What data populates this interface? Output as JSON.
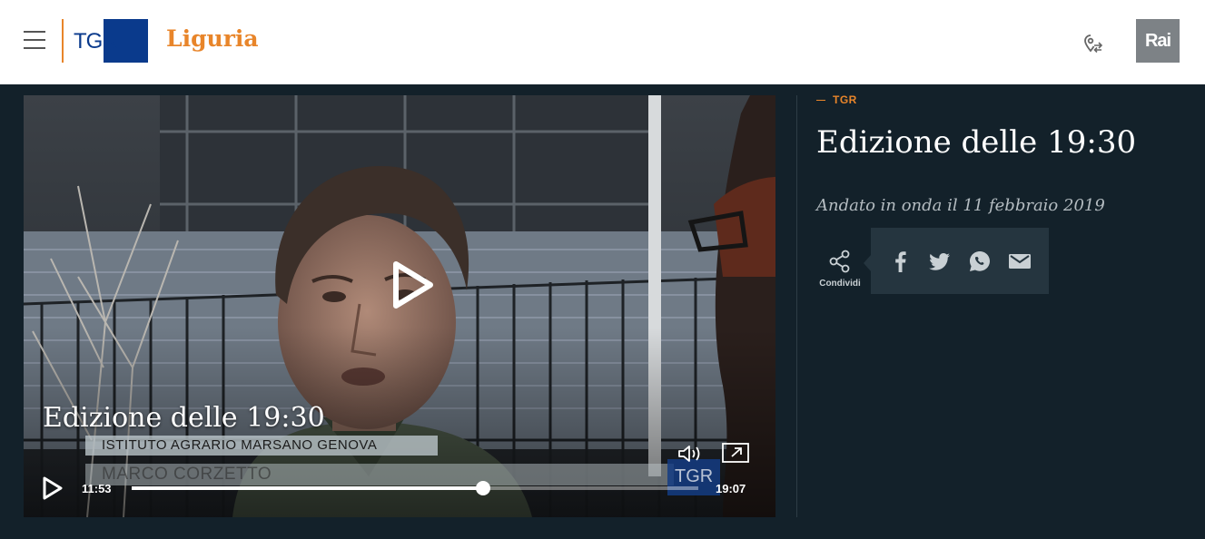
{
  "header": {
    "logo_text": "TGR",
    "region": "Liguria",
    "rai_logo": "Rai",
    "icons": [
      "menu-icon",
      "location-switch-icon"
    ]
  },
  "player": {
    "title": "Edizione delle 19:30",
    "caption_line1": "ISTITUTO AGRARIO MARSANO GENOVA",
    "caption_line2": "MARCO CORZETTO",
    "channel_bug": "TGR",
    "current_time": "11:53",
    "total_time": "19:07",
    "progress": 0.62,
    "icons": [
      "play-icon",
      "volume-icon",
      "picture-in-picture-icon"
    ]
  },
  "info": {
    "kicker": "TGR",
    "title": "Edizione delle 19:30",
    "aired": "Andato in onda il 11 febbraio 2019",
    "share_label": "Condividi",
    "social": [
      "facebook-icon",
      "twitter-icon",
      "whatsapp-icon",
      "email-icon"
    ]
  },
  "colors": {
    "accent": "#e8852a",
    "background": "#13212a",
    "share_panel": "#25353f",
    "tgr_blue": "#0a3a8c"
  }
}
